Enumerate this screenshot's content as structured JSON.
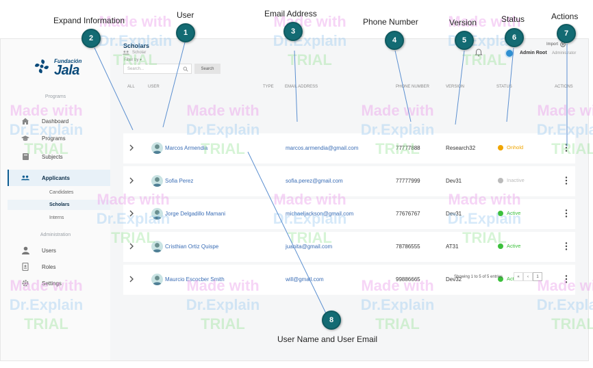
{
  "callouts": [
    {
      "num": "1",
      "label": "User"
    },
    {
      "num": "2",
      "label": "Expand Information"
    },
    {
      "num": "3",
      "label": "Email Address"
    },
    {
      "num": "4",
      "label": "Phone Number"
    },
    {
      "num": "5",
      "label": "Version"
    },
    {
      "num": "6",
      "label": "Status"
    },
    {
      "num": "7",
      "label": "Actions"
    },
    {
      "num": "8",
      "label": "User Name and User Email"
    }
  ],
  "brand": {
    "small": "Fundación",
    "big": "Jala"
  },
  "breadcrumb": "Scholar",
  "user": {
    "name": "Admin Root",
    "role": "Administrator"
  },
  "sidebar": {
    "section_programs": "Programs",
    "section_admin": "Administration",
    "items": [
      {
        "label": "Dashboard",
        "icon": "home-icon"
      },
      {
        "label": "Programs",
        "icon": "graduation-cap-icon"
      },
      {
        "label": "Subjects",
        "icon": "book-icon"
      },
      {
        "label": "Applicants",
        "icon": "users-icon"
      },
      {
        "label": "Users",
        "icon": "user-icon"
      },
      {
        "label": "Roles",
        "icon": "id-badge-icon"
      },
      {
        "label": "Settings",
        "icon": "gear-icon"
      }
    ],
    "subitems": [
      {
        "label": "Candidates"
      },
      {
        "label": "Scholars"
      },
      {
        "label": "Interns"
      }
    ]
  },
  "main": {
    "title": "Scholars",
    "import_label": "Import",
    "filter_label": "Filter by",
    "search_placeholder": "Search...",
    "search_button": "Search",
    "columns": [
      "ALL",
      "USER",
      "TYPE",
      "EMAIL ADDRESS",
      "PHONE NUMBER",
      "VERSION",
      "STATUS",
      "ACTIONS"
    ],
    "rows": [
      {
        "name": "Marcos Armendia",
        "email": "marcos.armendia@gmail.com",
        "phone": "77777888",
        "version": "Research32",
        "status": "Onhold",
        "status_color": "#f0a500"
      },
      {
        "name": "Sofia Perez",
        "email": "sofia.perez@gmail.com",
        "phone": "77777999",
        "version": "Dev31",
        "status": "Inactive",
        "status_color": "#bbbbbb"
      },
      {
        "name": "Jorge Delgadillo Mamani",
        "email": "michaeljackson@gmail.com",
        "phone": "77676767",
        "version": "Dev31",
        "status": "Active",
        "status_color": "#3cc03c"
      },
      {
        "name": "Cristhian Ortiz Quispe",
        "email": "juanita@gmail.com",
        "phone": "78786555",
        "version": "AT31",
        "status": "Active",
        "status_color": "#3cc03c"
      },
      {
        "name": "Maurcio Escocber Smith",
        "email": "will@gmail.com",
        "phone": "99886665",
        "version": "Dev32",
        "status": "Active",
        "status_color": "#3cc03c"
      }
    ],
    "showing": "Showing 1 to 5 of 5 entries",
    "pager": [
      "«",
      "‹",
      "1"
    ]
  },
  "watermark": {
    "line1": "Made with",
    "line2": "Dr.Explain",
    "line3": "TRIAL"
  },
  "colors": {
    "accent": "#136b73",
    "brand": "#0a4a7a",
    "link": "#3a6db5"
  }
}
